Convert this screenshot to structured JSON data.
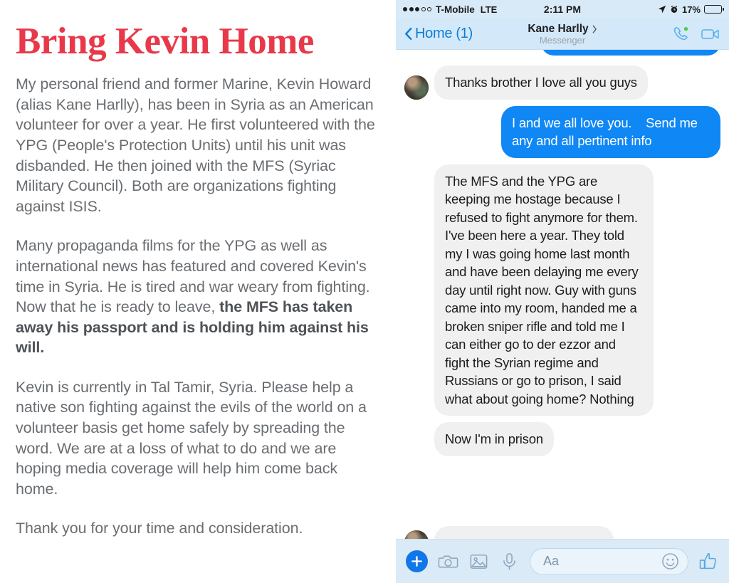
{
  "letter": {
    "title": "Bring Kevin Home",
    "paragraphs": [
      {
        "text": "My personal friend and former Marine, Kevin Howard (alias Kane Harlly), has been in Syria as an American volunteer for over a year. He first volunteered with the YPG (People's Protection Units) until his unit was disbanded. He then joined with the MFS (Syriac Military Council). Both are organizations fighting against ISIS."
      },
      {
        "text_normal_1": "Many propaganda films for the YPG as well as international news has featured and covered Kevin's time in Syria. He is tired and war weary from fighting. Now that he is ready to leave, ",
        "text_bold": "the MFS has taken away his passport and is holding him against his will."
      },
      {
        "text": "Kevin is currently in Tal Tamir, Syria. Please help a native son fighting against the evils of the world on a volunteer basis get home safely by spreading the word. We are at a loss of what to do and we are hoping media coverage will help him come back home."
      },
      {
        "text": "Thank you for your time and consideration."
      }
    ],
    "title_color": "#e8394a",
    "body_color": "#6a6e72"
  },
  "phone": {
    "status_bar": {
      "signal_bars_filled": 3,
      "signal_bars_total": 5,
      "carrier": "T-Mobile",
      "network": "LTE",
      "time": "2:11 PM",
      "location_icon": "location-arrow-icon",
      "alarm_icon": "alarm-clock-icon",
      "battery_percent": "17%",
      "battery_level": 17,
      "battery_color": "#f03b32"
    },
    "nav_bar": {
      "back_label": "Home (1)",
      "title": "Kane Harlly",
      "subtitle": "Messenger",
      "back_icon": "chevron-left-icon",
      "title_chevron_icon": "chevron-right-icon",
      "call_icon": "phone-call-icon",
      "video_icon": "video-camera-icon",
      "accent_color": "#0c7ed8"
    },
    "messages": [
      {
        "id": "m0",
        "side": "out",
        "text": "",
        "truncated": true,
        "note": "partially visible blue bubble cut off at top of thread"
      },
      {
        "id": "m1",
        "side": "in",
        "text": "Thanks brother I love all you guys",
        "has_avatar": true
      },
      {
        "id": "m2",
        "side": "out",
        "text": "I and we all love you.    Send me any and all pertinent info"
      },
      {
        "id": "m3",
        "side": "in",
        "text": "The MFS and the YPG are keeping me hostage because I refused to fight anymore for them. I've been here a year. They told my I was going home last month and have been delaying me every day until right now. Guy with guns came into my room, handed me a broken sniper rifle and told me I can either go to der ezzor and fight the Syrian regime and Russians or go to prison, I said what about going home? Nothing",
        "has_avatar": false
      },
      {
        "id": "m4",
        "side": "in",
        "text": "Now I'm in prison",
        "has_avatar": false
      },
      {
        "id": "m5",
        "side": "in",
        "text": "",
        "truncated": true,
        "has_avatar": true,
        "note": "partially visible gray bubble cut off at bottom of thread"
      }
    ],
    "composer": {
      "plus_icon": "plus-icon",
      "camera_icon": "camera-icon",
      "photo_icon": "photo-library-icon",
      "mic_icon": "microphone-icon",
      "input_placeholder": "Aa",
      "input_value": "",
      "emoji_icon": "smiley-face-icon",
      "like_icon": "thumbs-up-icon",
      "accent_color": "#1177e8"
    },
    "bubble_colors": {
      "incoming": "#f0f0f0",
      "outgoing": "#0f87f5"
    }
  }
}
